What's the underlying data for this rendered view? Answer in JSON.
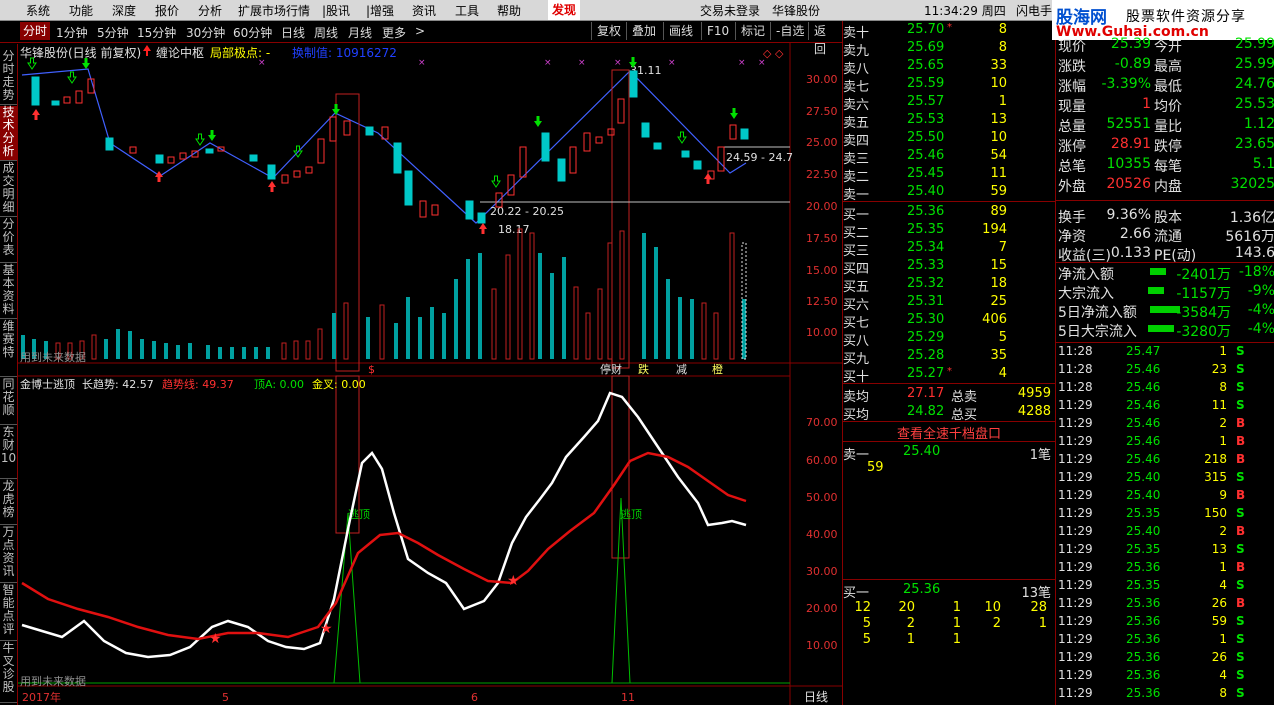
{
  "menu": {
    "items": [
      "系统",
      "功能",
      "深度",
      "报价",
      "分析",
      "扩展市场行情",
      "|股讯",
      "|增强",
      "资讯",
      "工具",
      "帮助",
      "发现"
    ],
    "status": "交易未登录",
    "stock_name": "华锋股份",
    "clock": "11:34:29 周四",
    "flash": "闪电手"
  },
  "logo": {
    "title": "股海网",
    "subtitle": "股票软件资源分享",
    "url": "Www.Guhai.com.cn"
  },
  "toolbar": {
    "periods": [
      "分时",
      "1分钟",
      "5分钟",
      "15分钟",
      "30分钟",
      "60分钟",
      "日线",
      "周线",
      "月线",
      "更多"
    ],
    "active_period": "分时",
    "more_arrow": ">",
    "buttons": [
      "复权",
      "叠加",
      "画线",
      "F10",
      "标记",
      "-自选",
      "返回"
    ]
  },
  "side_tabs": [
    "分时走势",
    "技术分析",
    "成交明细",
    "分价表",
    "基本资料",
    "维赛特",
    "同花顺",
    "东财10",
    "龙虎榜",
    "万点资讯",
    "智能点评",
    "牛叉诊股"
  ],
  "side_tabs_active": 1,
  "main_chart": {
    "title": "华锋股份(日线 前复权)",
    "indicator1": "缠论中枢",
    "indicator2": "局部极点: -",
    "overlay_label": "换制值: 10916272",
    "price_ticks": [
      "30.00",
      "27.50",
      "25.00",
      "22.50",
      "20.00",
      "17.50",
      "15.00",
      "12.50",
      "10.00"
    ],
    "annotations": {
      "high": "31.11",
      "low": "18.17",
      "zone1": "20.22 - 20.25",
      "zone2": "24.59 - 24.7"
    },
    "vol_markers": [
      "$",
      "停财",
      "跌",
      "减",
      "橙"
    ],
    "no_future": "用到未来数据"
  },
  "indicator_panel": {
    "name": "金博士逃顶",
    "long_trend_label": "长趋势: 42.57",
    "trend_line_label": "趋势线: 49.37",
    "top_a_label": "顶A: 0.00",
    "golden_cross_label": "金叉: 0.00",
    "escape_label": "逃顶",
    "ticks": [
      "70.00",
      "60.00",
      "50.00",
      "40.00",
      "30.00",
      "20.00",
      "10.00"
    ],
    "no_future": "用到未来数据"
  },
  "x_axis": {
    "labels": [
      "2017年",
      "5",
      "6",
      "11"
    ],
    "period": "日线"
  },
  "order_book": {
    "asks": [
      {
        "label": "卖十",
        "price": "25.70",
        "flag": "*",
        "vol": "8"
      },
      {
        "label": "卖九",
        "price": "25.69",
        "flag": "",
        "vol": "8"
      },
      {
        "label": "卖八",
        "price": "25.65",
        "flag": "",
        "vol": "33"
      },
      {
        "label": "卖七",
        "price": "25.59",
        "flag": "",
        "vol": "10"
      },
      {
        "label": "卖六",
        "price": "25.57",
        "flag": "",
        "vol": "1"
      },
      {
        "label": "卖五",
        "price": "25.53",
        "flag": "",
        "vol": "13"
      },
      {
        "label": "卖四",
        "price": "25.50",
        "flag": "",
        "vol": "10"
      },
      {
        "label": "卖三",
        "price": "25.46",
        "flag": "",
        "vol": "54"
      },
      {
        "label": "卖二",
        "price": "25.45",
        "flag": "",
        "vol": "11"
      },
      {
        "label": "卖一",
        "price": "25.40",
        "flag": "",
        "vol": "59"
      }
    ],
    "bids": [
      {
        "label": "买一",
        "price": "25.36",
        "flag": "",
        "vol": "89"
      },
      {
        "label": "买二",
        "price": "25.35",
        "flag": "",
        "vol": "194"
      },
      {
        "label": "买三",
        "price": "25.34",
        "flag": "",
        "vol": "7"
      },
      {
        "label": "买四",
        "price": "25.33",
        "flag": "",
        "vol": "15"
      },
      {
        "label": "买五",
        "price": "25.32",
        "flag": "",
        "vol": "18"
      },
      {
        "label": "买六",
        "price": "25.31",
        "flag": "",
        "vol": "25"
      },
      {
        "label": "买七",
        "price": "25.30",
        "flag": "",
        "vol": "406"
      },
      {
        "label": "买八",
        "price": "25.29",
        "flag": "",
        "vol": "5"
      },
      {
        "label": "买九",
        "price": "25.28",
        "flag": "",
        "vol": "35"
      },
      {
        "label": "买十",
        "price": "25.27",
        "flag": "*",
        "vol": "4"
      }
    ],
    "avg": [
      {
        "label": "卖均",
        "price": "27.17",
        "tlabel": "总卖",
        "total": "4959"
      },
      {
        "label": "买均",
        "price": "24.82",
        "tlabel": "总买",
        "total": "4288"
      }
    ],
    "full_depth_button": "查看全速千档盘口",
    "sell1": {
      "label": "卖一",
      "price": "25.40",
      "count": "1笔",
      "orders": [
        "59"
      ]
    },
    "buy1": {
      "label": "买一",
      "price": "25.36",
      "count": "13笔",
      "orders": [
        [
          "12",
          "20",
          "1",
          "10",
          "28"
        ],
        [
          "5",
          "2",
          "1",
          "2",
          "1"
        ],
        [
          "5",
          "1",
          "1",
          "",
          ""
        ]
      ]
    }
  },
  "quote_info": {
    "rows": [
      {
        "l": "现价",
        "v": "25.39",
        "l2": "今开",
        "v2": "25.99"
      },
      {
        "l": "涨跌",
        "v": "-0.89",
        "l2": "最高",
        "v2": "25.99"
      },
      {
        "l": "涨幅",
        "v": "-3.39%",
        "l2": "最低",
        "v2": "24.76"
      },
      {
        "l": "现量",
        "v": "1",
        "l2": "均价",
        "v2": "25.53"
      },
      {
        "l": "总量",
        "v": "52551",
        "l2": "量比",
        "v2": "1.12"
      },
      {
        "l": "涨停",
        "v": "28.91",
        "l2": "跌停",
        "v2": "23.65"
      },
      {
        "l": "总笔",
        "v": "10355",
        "l2": "每笔",
        "v2": "5.1"
      },
      {
        "l": "外盘",
        "v": "20526",
        "l2": "内盘",
        "v2": "32025"
      },
      {
        "l": "换手",
        "v": "9.36%",
        "l2": "股本",
        "v2": "1.36亿"
      },
      {
        "l": "净资",
        "v": "2.66",
        "l2": "流通",
        "v2": "5616万"
      },
      {
        "l": "收益(三)",
        "v": "0.133",
        "l2": "PE(动)",
        "v2": "143.6"
      }
    ],
    "flows": [
      {
        "l": "净流入额",
        "v": "-2401万",
        "p": "-18%"
      },
      {
        "l": "大宗流入",
        "v": "-1157万",
        "p": "-9%"
      },
      {
        "l": "5日净流入额",
        "v": "-3584万",
        "p": "-4%"
      },
      {
        "l": "5日大宗流入",
        "v": "-3280万",
        "p": "-4%"
      }
    ]
  },
  "ticks": [
    {
      "t": "11:28",
      "p": "25.47",
      "v": "1",
      "s": "S"
    },
    {
      "t": "11:28",
      "p": "25.46",
      "v": "23",
      "s": "S"
    },
    {
      "t": "11:28",
      "p": "25.46",
      "v": "8",
      "s": "S"
    },
    {
      "t": "11:29",
      "p": "25.46",
      "v": "11",
      "s": "S"
    },
    {
      "t": "11:29",
      "p": "25.46",
      "v": "2",
      "s": "B"
    },
    {
      "t": "11:29",
      "p": "25.46",
      "v": "1",
      "s": "B"
    },
    {
      "t": "11:29",
      "p": "25.46",
      "v": "218",
      "s": "B"
    },
    {
      "t": "11:29",
      "p": "25.40",
      "v": "315",
      "s": "S"
    },
    {
      "t": "11:29",
      "p": "25.40",
      "v": "9",
      "s": "B"
    },
    {
      "t": "11:29",
      "p": "25.35",
      "v": "150",
      "s": "S"
    },
    {
      "t": "11:29",
      "p": "25.40",
      "v": "2",
      "s": "B"
    },
    {
      "t": "11:29",
      "p": "25.35",
      "v": "13",
      "s": "S"
    },
    {
      "t": "11:29",
      "p": "25.36",
      "v": "1",
      "s": "B"
    },
    {
      "t": "11:29",
      "p": "25.35",
      "v": "4",
      "s": "S"
    },
    {
      "t": "11:29",
      "p": "25.36",
      "v": "26",
      "s": "B"
    },
    {
      "t": "11:29",
      "p": "25.36",
      "v": "59",
      "s": "S"
    },
    {
      "t": "11:29",
      "p": "25.36",
      "v": "1",
      "s": "S"
    },
    {
      "t": "11:29",
      "p": "25.36",
      "v": "26",
      "s": "S"
    },
    {
      "t": "11:29",
      "p": "25.36",
      "v": "4",
      "s": "S"
    },
    {
      "t": "11:29",
      "p": "25.36",
      "v": "8",
      "s": "S"
    }
  ],
  "colors": {
    "up": "#ff3030",
    "down": "#00c8c8",
    "yellow": "#ffff00",
    "green": "#00e000",
    "frame": "#800000",
    "trend": "#e01010"
  }
}
